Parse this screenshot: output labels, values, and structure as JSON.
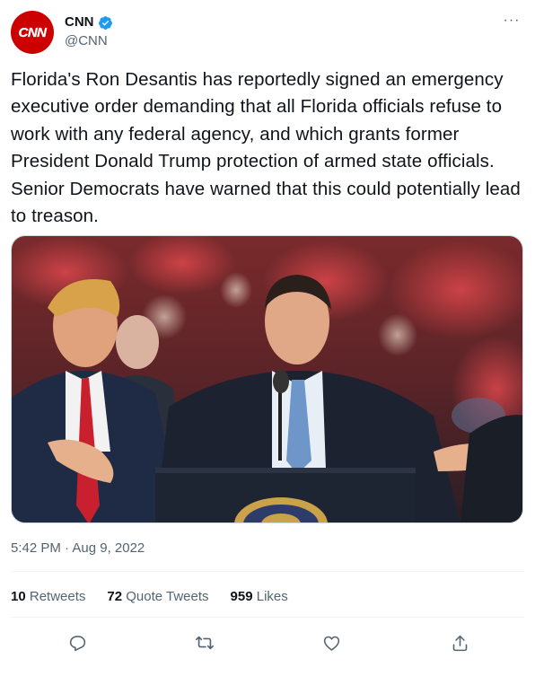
{
  "tweet": {
    "author": {
      "display_name": "CNN",
      "handle": "@CNN",
      "avatar_text": "CNN",
      "verified": true,
      "brand_color": "#cc0000"
    },
    "more_label": "···",
    "text": "Florida's Ron Desantis has reportedly signed an emergency executive order demanding that all Florida officials refuse to work with any federal agency, and which grants former President Donald Trump protection of armed state officials. Senior Democrats have warned that this could potentially lead to treason.",
    "timestamp": "5:42 PM · Aug 9, 2022",
    "stats": {
      "retweets_count": "10",
      "retweets_label": "Retweets",
      "quotes_count": "72",
      "quotes_label": "Quote Tweets",
      "likes_count": "959",
      "likes_label": "Likes"
    },
    "actions": [
      "reply-icon",
      "retweet-icon",
      "like-icon",
      "share-icon"
    ]
  }
}
